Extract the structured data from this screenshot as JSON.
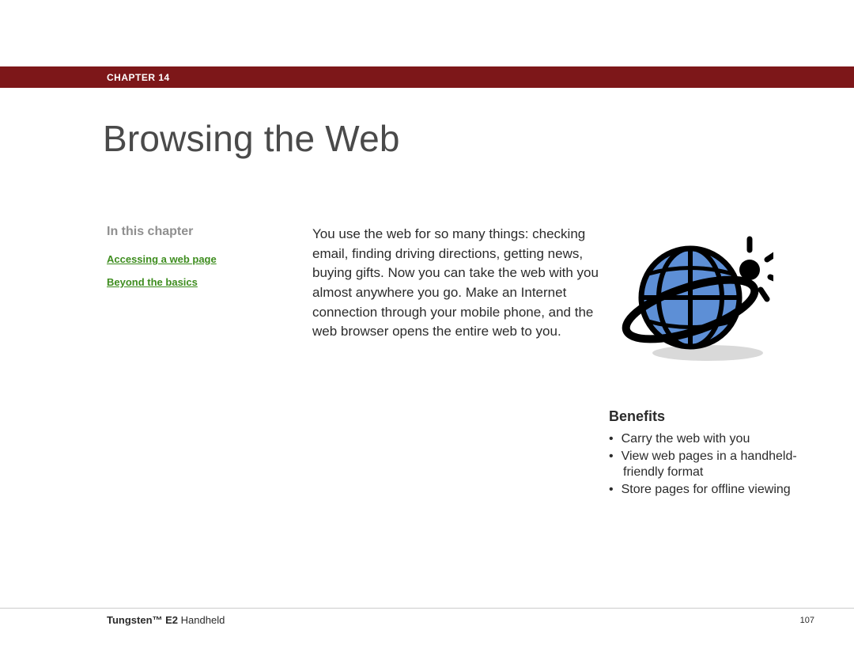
{
  "chapter_label": "CHAPTER 14",
  "title": "Browsing the Web",
  "sidebar": {
    "heading": "In this chapter",
    "links": [
      "Accessing a web page",
      "Beyond the basics"
    ]
  },
  "intro": "You use the web for so many things: checking email, finding driving directions, getting news, buying gifts. Now you can take the web with you almost anywhere you go. Make an Internet connection through your mobile phone, and the web browser opens the entire web to you.",
  "benefits": {
    "heading": "Benefits",
    "items": [
      "Carry the web with you",
      "View web pages in a handheld-friendly format",
      "Store pages for offline viewing"
    ]
  },
  "footer": {
    "product_bold": "Tungsten™ E2",
    "product_rest": " Handheld",
    "page_number": "107"
  }
}
